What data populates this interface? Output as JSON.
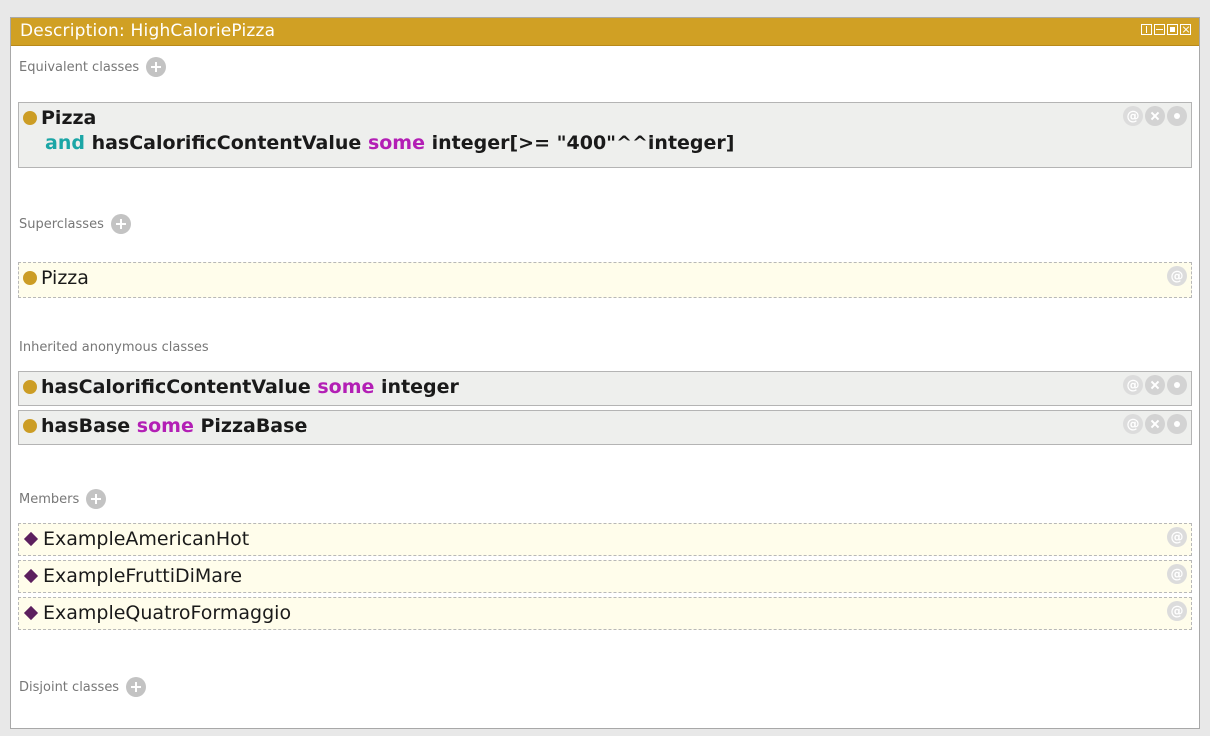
{
  "window": {
    "title": "Description: HighCaloriePizza"
  },
  "sections": {
    "equivalent": {
      "label": "Equivalent classes",
      "rows": [
        {
          "line1": "Pizza",
          "and_kw": "and",
          "property": "hasCalorificContentValue",
          "some_kw": "some",
          "filler": "integer[>= \"400\"^^integer]"
        }
      ]
    },
    "superclasses": {
      "label": "Superclasses",
      "rows": [
        {
          "text": "Pizza"
        }
      ]
    },
    "inherited": {
      "label": "Inherited anonymous classes",
      "rows": [
        {
          "property": "hasCalorificContentValue",
          "some_kw": "some",
          "filler": "integer"
        },
        {
          "property": "hasBase",
          "some_kw": "some",
          "filler": "PizzaBase"
        }
      ]
    },
    "members": {
      "label": "Members",
      "rows": [
        {
          "text": "ExampleAmericanHot"
        },
        {
          "text": "ExampleFruttiDiMare"
        },
        {
          "text": "ExampleQuatroFormaggio"
        }
      ]
    },
    "disjoint": {
      "label": "Disjoint classes"
    }
  },
  "icons": {
    "annotate": "@",
    "class_color": "#cc9d25",
    "individual_color": "#5c1f5e",
    "titlebar_color": "#d0a024"
  }
}
